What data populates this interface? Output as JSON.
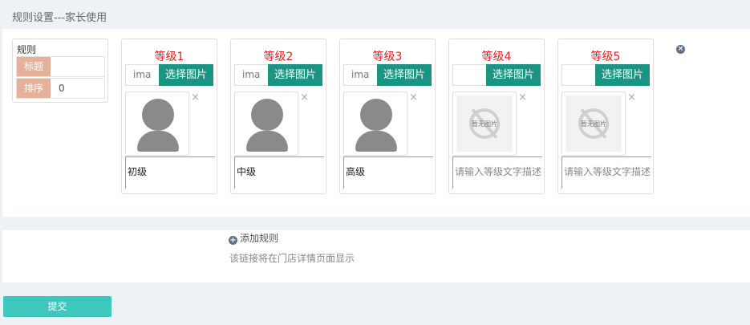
{
  "page": {
    "title": "规则设置---家长使用"
  },
  "rule": {
    "label": "规则",
    "title_tag": "标题",
    "title_value": "",
    "order_tag": "排序",
    "order_value": "0"
  },
  "levels": [
    {
      "title": "等级1",
      "img_value": "ima",
      "choose_label": "选择图片",
      "image": "avatar-icon",
      "remove": "×",
      "description": "初级",
      "placeholder": "请输入等级文字描述"
    },
    {
      "title": "等级2",
      "img_value": "ima",
      "choose_label": "选择图片",
      "image": "avatar-icon",
      "remove": "×",
      "description": "中级",
      "placeholder": "请输入等级文字描述"
    },
    {
      "title": "等级3",
      "img_value": "ima",
      "choose_label": "选择图片",
      "image": "avatar-icon",
      "remove": "×",
      "description": "高级",
      "placeholder": "请输入等级文字描述"
    },
    {
      "title": "等级4",
      "img_value": "",
      "choose_label": "选择图片",
      "image": "no-image-icon",
      "no_image_text": "暂无图片",
      "remove": "×",
      "description": "",
      "placeholder": "请输入等级文字描述"
    },
    {
      "title": "等级5",
      "img_value": "",
      "choose_label": "选择图片",
      "image": "no-image-icon",
      "no_image_text": "暂无图片",
      "remove": "×",
      "description": "",
      "placeholder": "请输入等级文字描述"
    }
  ],
  "delete_icon": "×",
  "add_rule": {
    "icon": "+",
    "label": "添加规则"
  },
  "hint": "该链接将在门店详情页面显示",
  "submit_label": "提交",
  "colors": {
    "level_title": "#e02020",
    "choose_button": "#1b9484",
    "submit_button": "#3ec8bd",
    "tag_bg": "#e0a48a"
  }
}
